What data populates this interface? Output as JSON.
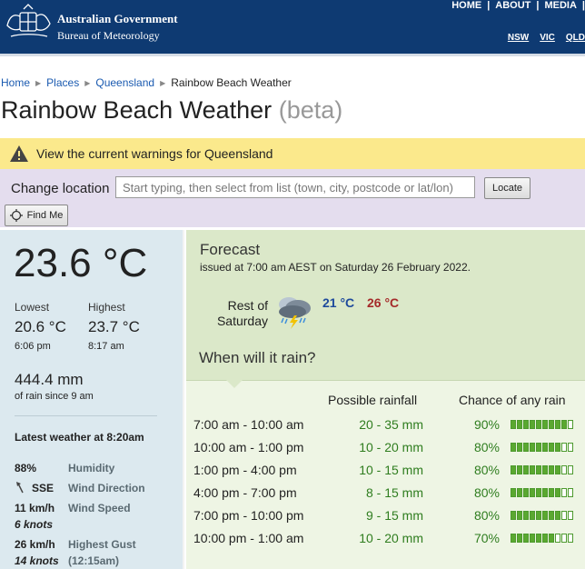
{
  "header": {
    "org_line1": "Australian Government",
    "org_line2": "Bureau of Meteorology",
    "nav": [
      "HOME",
      "ABOUT",
      "MEDIA"
    ],
    "states": [
      "NSW",
      "VIC",
      "QLD"
    ]
  },
  "breadcrumb": {
    "items": [
      "Home",
      "Places",
      "Queensland"
    ],
    "current": "Rainbow Beach Weather"
  },
  "page": {
    "title": "Rainbow Beach Weather",
    "beta": "(beta)"
  },
  "warning": {
    "text": "View the current warnings for Queensland"
  },
  "location": {
    "label": "Change location",
    "placeholder": "Start typing, then select from list (town, city, postcode or lat/lon)",
    "locate_label": "Locate",
    "findme_label": "Find Me"
  },
  "current": {
    "temperature": "23.6 °C",
    "lowest_label": "Lowest",
    "lowest_value": "20.6 °C",
    "lowest_time": "6:06 pm",
    "highest_label": "Highest",
    "highest_value": "23.7 °C",
    "highest_time": "8:17 am",
    "rain_value": "444.4 mm",
    "rain_since": "of rain since 9 am",
    "latest_label": "Latest weather at 8:20am",
    "humidity_value": "88%",
    "humidity_label": "Humidity",
    "wind_dir_value": "SSE",
    "wind_dir_label": "Wind Direction",
    "wind_speed_value": "11 km/h",
    "wind_speed_label": "Wind Speed",
    "wind_speed_knots": "6 knots",
    "gust_value": "26 km/h",
    "gust_label": "Highest Gust",
    "gust_knots": "14 knots",
    "gust_time": "(12:15am)"
  },
  "forecast": {
    "title": "Forecast",
    "issued": "issued at 7:00 am AEST on Saturday 26 February 2022.",
    "day_label_1": "Rest of",
    "day_label_2": "Saturday",
    "icon": "storm-icon",
    "min_temp": "21 °C",
    "max_temp": "26 °C",
    "rain_question": "When will it rain?",
    "col_rainfall": "Possible rainfall",
    "col_chance": "Chance of any rain",
    "rows": [
      {
        "time": "7:00 am - 10:00 am",
        "amount": "20 - 35 mm",
        "chance": "90%",
        "chance_level": 0.9
      },
      {
        "time": "10:00 am - 1:00 pm",
        "amount": "10 - 20 mm",
        "chance": "80%",
        "chance_level": 0.8
      },
      {
        "time": "1:00 pm - 4:00 pm",
        "amount": "10 - 15 mm",
        "chance": "80%",
        "chance_level": 0.8
      },
      {
        "time": "4:00 pm - 7:00 pm",
        "amount": "8 - 15 mm",
        "chance": "80%",
        "chance_level": 0.8
      },
      {
        "time": "7:00 pm - 10:00 pm",
        "amount": "9 - 15 mm",
        "chance": "80%",
        "chance_level": 0.8
      },
      {
        "time": "10:00 pm - 1:00 am",
        "amount": "10 - 20 mm",
        "chance": "70%",
        "chance_level": 0.7
      }
    ]
  },
  "colors": {
    "header_bg": "#0e3a72",
    "warning_bg": "#fbe98c",
    "location_bg": "#e4ddee",
    "left_panel_bg": "#dce9ef",
    "forecast_bg": "#dbe8c9",
    "rain_green": "#2f7d1f",
    "min_blue": "#1e4a9c",
    "max_red": "#a52a2a"
  }
}
